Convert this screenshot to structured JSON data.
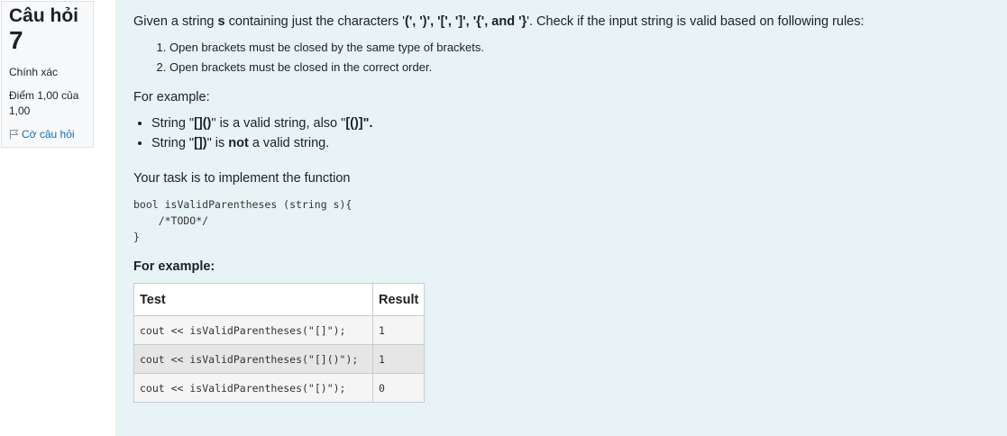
{
  "question_info": {
    "label": "Câu hỏi",
    "number": "7",
    "state": "Chính xác",
    "grade": "Điểm 1,00 của 1,00",
    "flag_label": "Cờ câu hỏi"
  },
  "content": {
    "intro_pre": "Given a string ",
    "intro_var": "s",
    "intro_mid": " containing just the characters '",
    "intro_chars": "(', ')', '[', ']', '{', and '}",
    "intro_post": "'. Check if the input string is valid based on following rules:",
    "rules": [
      "Open brackets must be closed by the same type of brackets.",
      "Open brackets must be closed in the correct order."
    ],
    "for_example": "For example:",
    "bullet1_pre": "String \"",
    "bullet1_val": "[]()",
    "bullet1_mid": "\" is a valid string, also \"",
    "bullet1_val2": "[()]",
    "bullet1_post": "\".",
    "bullet2_pre": "String \"",
    "bullet2_val": "[])",
    "bullet2_mid": "\" is ",
    "bullet2_not": "not",
    "bullet2_post": " a valid string.",
    "task": "Your task is to implement the function",
    "code_line1": "bool isValidParentheses (string s){",
    "code_line2": "    /*TODO*/",
    "code_line3": "}",
    "example_heading": "For example:"
  },
  "table": {
    "headers": [
      "Test",
      "Result"
    ],
    "rows": [
      {
        "test": "cout << isValidParentheses(\"[]\");",
        "result": "1"
      },
      {
        "test": "cout << isValidParentheses(\"[]()\");",
        "result": "1"
      },
      {
        "test": "cout << isValidParentheses(\"[)\");",
        "result": "0"
      }
    ]
  },
  "colors": {
    "content_bg": "#e7f3f5",
    "info_bg": "#f8f9fa",
    "link": "#0f6cbf"
  },
  "icons": {
    "flag": "flag-icon"
  }
}
